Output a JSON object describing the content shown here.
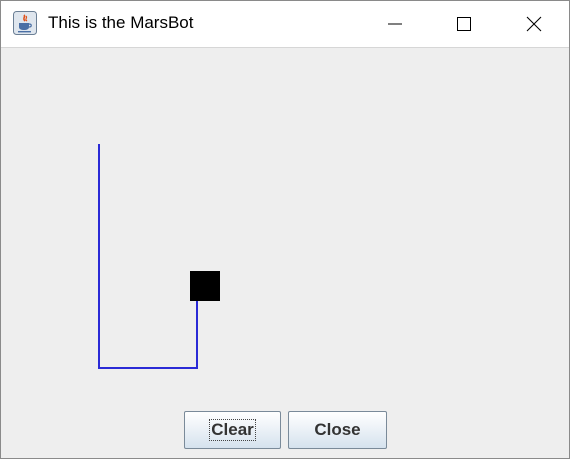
{
  "window": {
    "title": "This is the MarsBot",
    "app_icon": "java-cup-icon"
  },
  "title_controls": {
    "minimize_icon": "minimize-icon",
    "maximize_icon": "maximize-icon",
    "close_icon": "close-icon"
  },
  "canvas": {
    "path_color": "#2a2ad6",
    "robot_color": "#000000"
  },
  "buttons": {
    "clear_label": "Clear",
    "close_label": "Close"
  }
}
